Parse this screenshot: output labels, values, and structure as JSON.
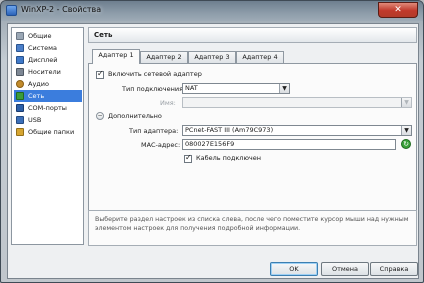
{
  "window": {
    "title": "WinXP-2 - Свойства",
    "close_glyph": "✕"
  },
  "sidebar": {
    "items": [
      {
        "label": "Общие",
        "icon": "general-icon",
        "color": "#9aa7b5"
      },
      {
        "label": "Система",
        "icon": "system-icon",
        "color": "#4b7fc9"
      },
      {
        "label": "Дисплей",
        "icon": "display-icon",
        "color": "#3f79c9"
      },
      {
        "label": "Носители",
        "icon": "storage-icon",
        "color": "#7d8794"
      },
      {
        "label": "Аудио",
        "icon": "audio-icon",
        "color": "#c28b2c"
      },
      {
        "label": "Сеть",
        "icon": "network-icon",
        "color": "#3a9c3a",
        "selected": true
      },
      {
        "label": "COM-порты",
        "icon": "serial-port-icon",
        "color": "#2c5fa8"
      },
      {
        "label": "USB",
        "icon": "usb-icon",
        "color": "#3b6fb8"
      },
      {
        "label": "Общие папки",
        "icon": "shared-folders-icon",
        "color": "#d6a531"
      }
    ],
    "selected_color": "#3b7ddd"
  },
  "section": {
    "title": "Сеть"
  },
  "tabs": [
    "Адаптер 1",
    "Адаптер 2",
    "Адаптер 3",
    "Адаптер 4"
  ],
  "adapter": {
    "enable_label": "Включить сетевой адаптер",
    "enabled": true,
    "attachment_label": "Тип подключения:",
    "attachment_value": "NAT",
    "name_label": "Имя:",
    "name_value": "",
    "advanced_label": "Дополнительно",
    "type_label": "Тип адаптера:",
    "type_value": "PCnet-FAST III (Am79C973)",
    "mac_label": "MAC-адрес:",
    "mac_value": "080027E156F9",
    "cable_label": "Кабель подключен",
    "cable_connected": true,
    "arrow_glyph": "▼",
    "expander_glyph": "−",
    "refresh_glyph": "↻"
  },
  "info": {
    "text": "Выберите раздел настроек из списка слева, после чего поместите курсор мыши над нужным элементом настроек для получения подробной информации."
  },
  "buttons": {
    "ok": "OK",
    "cancel": "Отмена",
    "help": "Справка"
  }
}
